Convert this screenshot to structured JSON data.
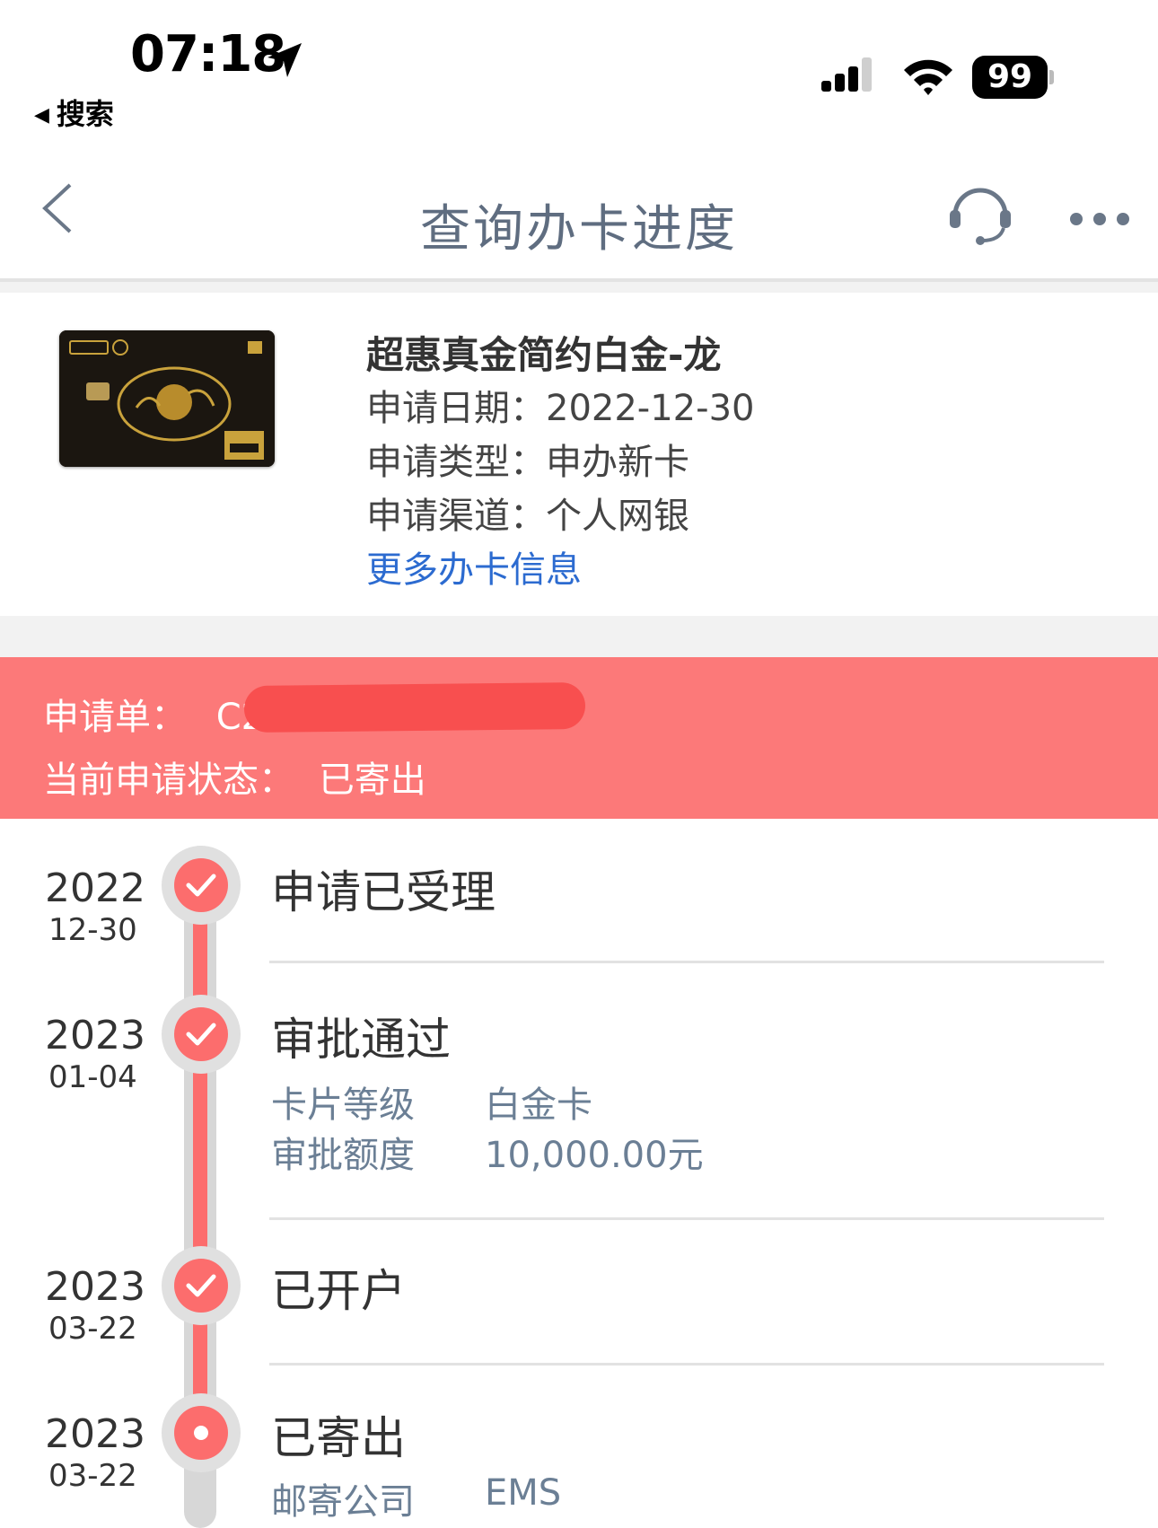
{
  "status_bar": {
    "time": "07:18",
    "back_label": "搜索",
    "battery": "99",
    "icons": [
      "location-arrow-icon",
      "signal-icon",
      "wifi-icon",
      "battery-icon"
    ]
  },
  "nav": {
    "title": "查询办卡进度",
    "icons": [
      "back-chevron-icon",
      "customer-service-headset-icon",
      "more-dots-icon"
    ]
  },
  "card": {
    "name": "超惠真金简约白金-龙",
    "apply_date_label": "申请日期：",
    "apply_date": "2022-12-30",
    "apply_type_label": "申请类型：",
    "apply_type": "申办新卡",
    "apply_channel_label": "申请渠道：",
    "apply_channel": "个人网银",
    "more_link": "更多办卡信息"
  },
  "banner": {
    "order_label": "申请单：",
    "order_no_visible": "C2",
    "status_label": "当前申请状态：",
    "status_value": "已寄出",
    "background": "#fc7979"
  },
  "timeline": [
    {
      "year": "2022",
      "md": "12-30",
      "title": "申请已受理",
      "state": "done"
    },
    {
      "year": "2023",
      "md": "01-04",
      "title": "审批通过",
      "state": "done",
      "details": [
        {
          "label": "卡片等级",
          "value": "白金卡"
        },
        {
          "label": "审批额度",
          "value": "10,000.00元"
        }
      ]
    },
    {
      "year": "2023",
      "md": "03-22",
      "title": "已开户",
      "state": "done"
    },
    {
      "year": "2023",
      "md": "03-22",
      "title": "已寄出",
      "state": "current",
      "details": [
        {
          "label": "邮寄公司",
          "value": "EMS"
        }
      ]
    }
  ],
  "colors": {
    "accent_red": "#fc6d6d",
    "link_blue": "#2c6bd0",
    "title_gray_blue": "#5f6d80"
  }
}
